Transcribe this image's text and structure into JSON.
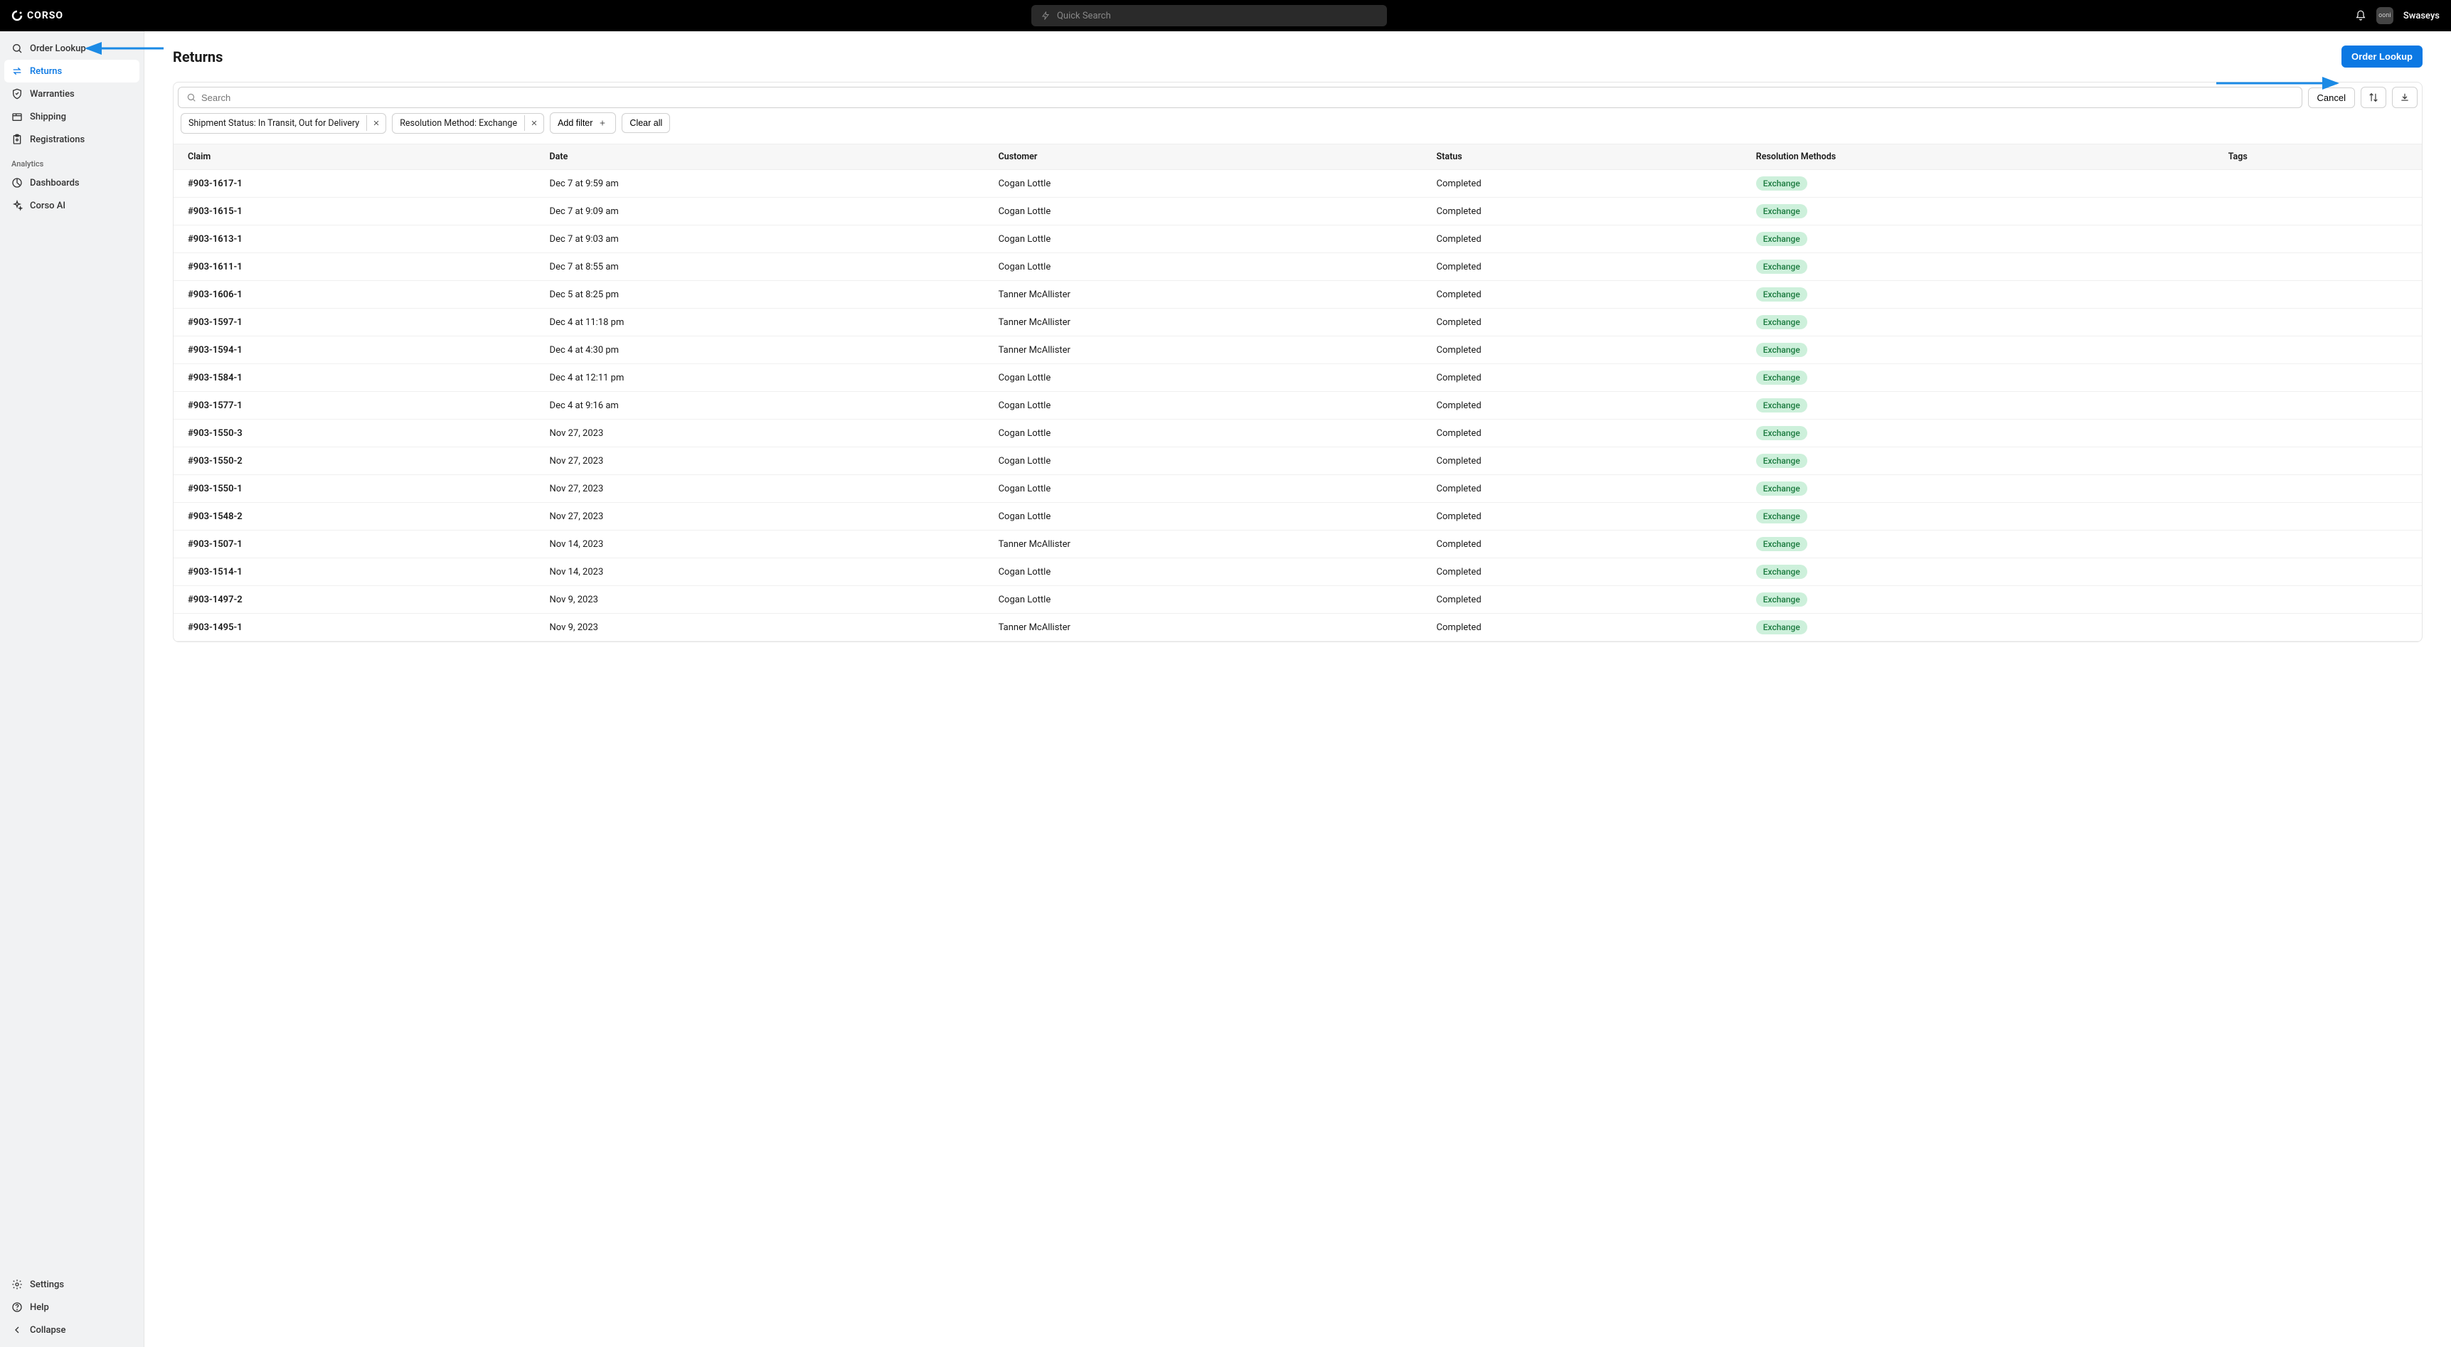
{
  "brand": "CORSO",
  "quick_search_placeholder": "Quick Search",
  "user_name": "Swaseys",
  "avatar_text": "ooni",
  "sidebar": {
    "items": [
      {
        "label": "Order Lookup",
        "icon": "search"
      },
      {
        "label": "Returns",
        "icon": "swap",
        "active": true
      },
      {
        "label": "Warranties",
        "icon": "shield"
      },
      {
        "label": "Shipping",
        "icon": "package"
      },
      {
        "label": "Registrations",
        "icon": "clipboard"
      }
    ],
    "analytics_label": "Analytics",
    "analytics_items": [
      {
        "label": "Dashboards",
        "icon": "chart"
      },
      {
        "label": "Corso AI",
        "icon": "sparkle"
      }
    ],
    "bottom_items": [
      {
        "label": "Settings",
        "icon": "gear"
      },
      {
        "label": "Help",
        "icon": "help"
      },
      {
        "label": "Collapse",
        "icon": "chevron-left"
      }
    ]
  },
  "page": {
    "title": "Returns",
    "order_lookup_btn": "Order Lookup",
    "search_placeholder": "Search",
    "cancel_btn": "Cancel",
    "filters": [
      "Shipment Status: In Transit, Out for Delivery",
      "Resolution Method: Exchange"
    ],
    "add_filter": "Add filter",
    "clear_all": "Clear all",
    "columns": [
      "Claim",
      "Date",
      "Customer",
      "Status",
      "Resolution Methods",
      "Tags"
    ],
    "rows": [
      {
        "claim": "#903-1617-1",
        "date": "Dec 7 at 9:59 am",
        "customer": "Cogan Lottle",
        "status": "Completed",
        "resolution": "Exchange"
      },
      {
        "claim": "#903-1615-1",
        "date": "Dec 7 at 9:09 am",
        "customer": "Cogan Lottle",
        "status": "Completed",
        "resolution": "Exchange"
      },
      {
        "claim": "#903-1613-1",
        "date": "Dec 7 at 9:03 am",
        "customer": "Cogan Lottle",
        "status": "Completed",
        "resolution": "Exchange"
      },
      {
        "claim": "#903-1611-1",
        "date": "Dec 7 at 8:55 am",
        "customer": "Cogan Lottle",
        "status": "Completed",
        "resolution": "Exchange"
      },
      {
        "claim": "#903-1606-1",
        "date": "Dec 5 at 8:25 pm",
        "customer": "Tanner McAllister",
        "status": "Completed",
        "resolution": "Exchange"
      },
      {
        "claim": "#903-1597-1",
        "date": "Dec 4 at 11:18 pm",
        "customer": "Tanner McAllister",
        "status": "Completed",
        "resolution": "Exchange"
      },
      {
        "claim": "#903-1594-1",
        "date": "Dec 4 at 4:30 pm",
        "customer": "Tanner McAllister",
        "status": "Completed",
        "resolution": "Exchange"
      },
      {
        "claim": "#903-1584-1",
        "date": "Dec 4 at 12:11 pm",
        "customer": "Cogan Lottle",
        "status": "Completed",
        "resolution": "Exchange"
      },
      {
        "claim": "#903-1577-1",
        "date": "Dec 4 at 9:16 am",
        "customer": "Cogan Lottle",
        "status": "Completed",
        "resolution": "Exchange"
      },
      {
        "claim": "#903-1550-3",
        "date": "Nov 27, 2023",
        "customer": "Cogan Lottle",
        "status": "Completed",
        "resolution": "Exchange"
      },
      {
        "claim": "#903-1550-2",
        "date": "Nov 27, 2023",
        "customer": "Cogan Lottle",
        "status": "Completed",
        "resolution": "Exchange"
      },
      {
        "claim": "#903-1550-1",
        "date": "Nov 27, 2023",
        "customer": "Cogan Lottle",
        "status": "Completed",
        "resolution": "Exchange"
      },
      {
        "claim": "#903-1548-2",
        "date": "Nov 27, 2023",
        "customer": "Cogan Lottle",
        "status": "Completed",
        "resolution": "Exchange"
      },
      {
        "claim": "#903-1507-1",
        "date": "Nov 14, 2023",
        "customer": "Tanner McAllister",
        "status": "Completed",
        "resolution": "Exchange"
      },
      {
        "claim": "#903-1514-1",
        "date": "Nov 14, 2023",
        "customer": "Cogan Lottle",
        "status": "Completed",
        "resolution": "Exchange"
      },
      {
        "claim": "#903-1497-2",
        "date": "Nov 9, 2023",
        "customer": "Cogan Lottle",
        "status": "Completed",
        "resolution": "Exchange"
      },
      {
        "claim": "#903-1495-1",
        "date": "Nov 9, 2023",
        "customer": "Tanner McAllister",
        "status": "Completed",
        "resolution": "Exchange"
      }
    ]
  }
}
